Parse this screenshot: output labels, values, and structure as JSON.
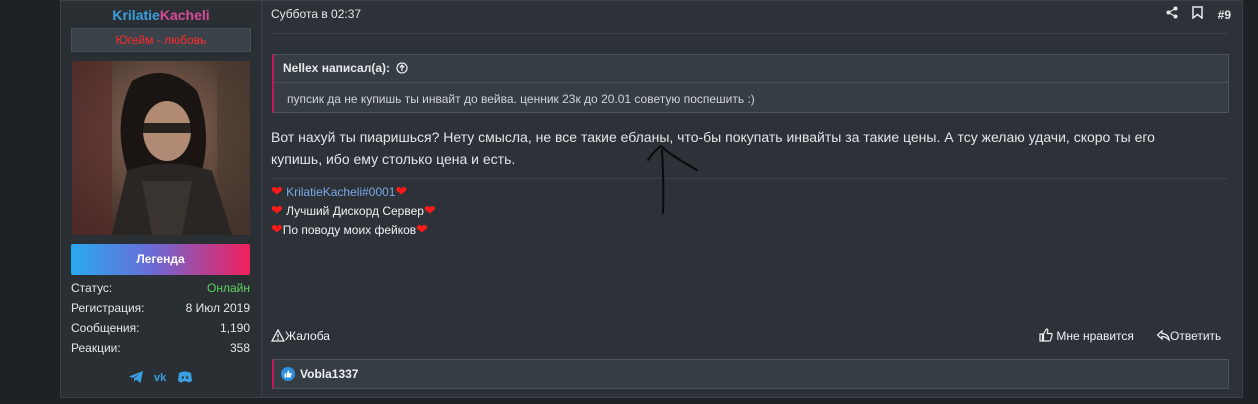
{
  "user": {
    "name_part1": "Krilatie",
    "name_part2": "Kacheli",
    "title": "Югейм - любовь",
    "banner": "Легенда",
    "stats": [
      {
        "key": "Статус:",
        "value": "Онлайн"
      },
      {
        "key": "Регистрация:",
        "value": "8 Июл 2019"
      },
      {
        "key": "Сообщения:",
        "value": "1,190"
      },
      {
        "key": "Реакции:",
        "value": "358"
      }
    ],
    "social_icons": [
      "telegram-icon",
      "vk-icon",
      "discord-icon"
    ]
  },
  "post": {
    "date": "Суббота в 02:37",
    "number": "#9",
    "quote_author": "Nellex написал(а):",
    "quote_text": "пупсик да не купишь ты инвайт до вейва. ценник 23к до 20.01 советую поспешить :)",
    "message_line1": "Вот нахуй ты пиаришься? Нету смысла, не все такие ебланы, что-бы покупать инвайты за такие цены. А тсу желаю удачи, скоро ты его",
    "message_line2": "купишь, ибо ему столько цена и есть.",
    "signature": [
      "KrilatieKacheli#0001",
      "Лучший Дискорд Сервер",
      "По поводу моих фейков"
    ],
    "report_label": "Жалоба",
    "like_label": "Мне нравится",
    "reply_label": "Ответить",
    "reaction_user": "Vobla1337"
  },
  "colors": {
    "page_bg": "#1e2226",
    "post_bg": "#2c3237",
    "accent_pink": "#c2185b",
    "online_green": "#5fd35f",
    "title_red": "#ff2b2b"
  }
}
